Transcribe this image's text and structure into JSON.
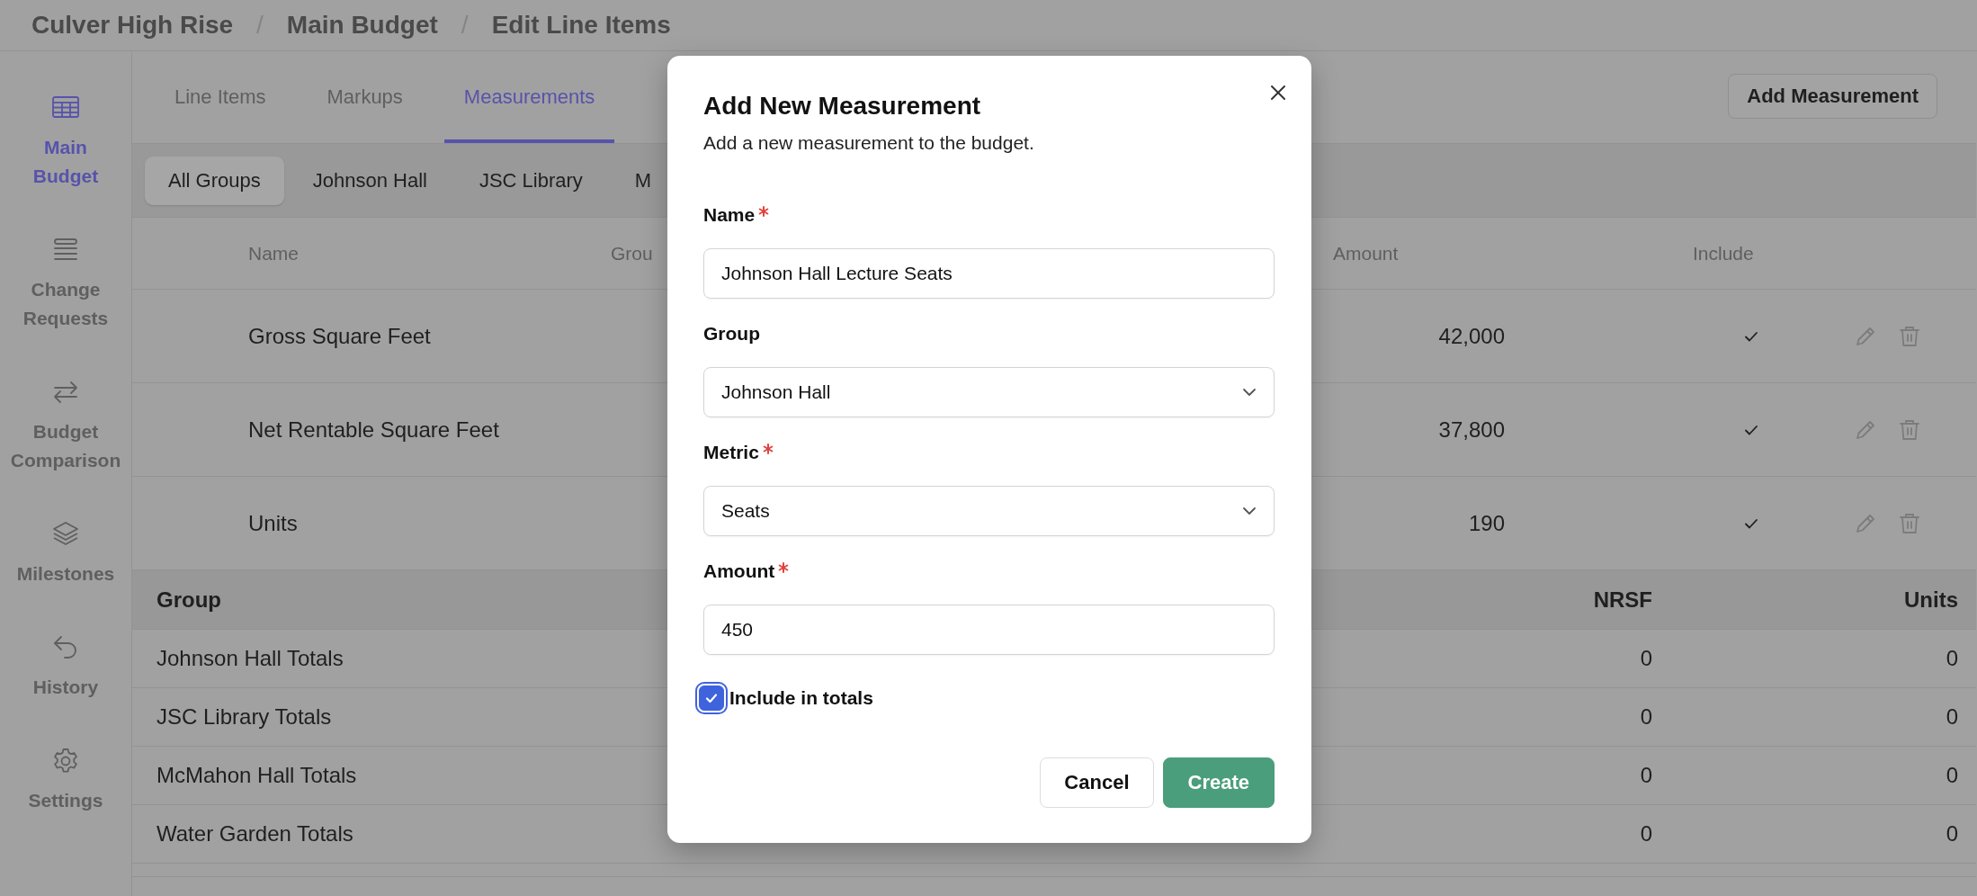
{
  "breadcrumb": {
    "separator": "/",
    "items": [
      "Culver High Rise",
      "Main Budget",
      "Edit Line Items"
    ]
  },
  "sidebar": {
    "items": [
      {
        "label": "Main Budget",
        "kind": "table",
        "selected": true
      },
      {
        "label": "Change Requests",
        "kind": "list",
        "selected": false
      },
      {
        "label": "Budget Comparison",
        "kind": "swap",
        "selected": false
      },
      {
        "label": "Milestones",
        "kind": "layers",
        "selected": false
      },
      {
        "label": "History",
        "kind": "undo",
        "selected": false
      },
      {
        "label": "Settings",
        "kind": "gear",
        "selected": false
      }
    ]
  },
  "tabs": [
    {
      "label": "Line Items",
      "selected": false
    },
    {
      "label": "Markups",
      "selected": false
    },
    {
      "label": "Measurements",
      "selected": true
    }
  ],
  "add_button": "Add Measurement",
  "group_filters": [
    {
      "label": "All Groups",
      "selected": true
    },
    {
      "label": "Johnson Hall",
      "selected": false
    },
    {
      "label": "JSC Library",
      "selected": false
    },
    {
      "label": "M",
      "selected": false
    }
  ],
  "measurements": {
    "columns": [
      "Name",
      "Grou",
      "Amount",
      "Include"
    ],
    "rows": [
      {
        "name": "Gross Square Feet",
        "amount": "42,000",
        "include": true
      },
      {
        "name": "Net Rentable Square Feet",
        "amount": "37,800",
        "include": true
      },
      {
        "name": "Units",
        "amount": "190",
        "include": true
      }
    ]
  },
  "totals": {
    "columns": [
      "Group",
      "NRSF",
      "Units"
    ],
    "rows": [
      {
        "group": "Johnson Hall Totals",
        "nrsf": "0",
        "units": "0"
      },
      {
        "group": "JSC Library Totals",
        "nrsf": "0",
        "units": "0"
      },
      {
        "group": "McMahon Hall Totals",
        "nrsf": "0",
        "units": "0"
      },
      {
        "group": "Water Garden Totals",
        "nrsf": "0",
        "units": "0"
      }
    ]
  },
  "dialog": {
    "title": "Add New Measurement",
    "subtitle": "Add a new measurement to the budget.",
    "fields": [
      {
        "kind": "text",
        "label": "Name",
        "required": true,
        "value": "Johnson Hall Lecture Seats"
      },
      {
        "kind": "select",
        "label": "Group",
        "required": false,
        "value": "Johnson Hall"
      },
      {
        "kind": "select",
        "label": "Metric",
        "required": true,
        "value": "Seats"
      },
      {
        "kind": "text",
        "label": "Amount",
        "required": true,
        "value": "450"
      }
    ],
    "checkbox": {
      "label": "Include in totals",
      "checked": true
    },
    "buttons": [
      {
        "label": "Cancel",
        "kind": "secondary"
      },
      {
        "label": "Create",
        "kind": "primary"
      }
    ]
  }
}
